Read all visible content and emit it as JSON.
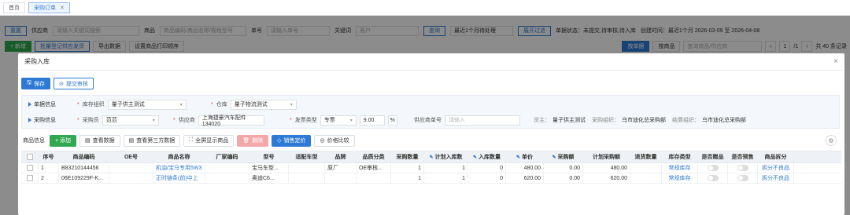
{
  "tabs": [
    {
      "label": "首页",
      "active": false
    },
    {
      "label": "采购订单",
      "active": true
    }
  ],
  "background": {
    "filter": {
      "reset": "重置",
      "supplier_label": "供应商",
      "supplier_placeholder": "请输入关键词搜索",
      "goods_label": "商品",
      "goods_placeholder": "商品编码/商品名称/规格型号",
      "order_no_label": "单号",
      "order_no_placeholder": "请输入单号",
      "keyword_label": "关键词",
      "keyword_placeholder": "客户",
      "search_button": "查询",
      "range_select": "最近1个月待处理",
      "expand_button": "展开过滤",
      "status_text": "单据状态：未提交,待审核,待入库",
      "create_time_text": "创建时间：最近1个月 2026-03-09 至 2026-04-08"
    },
    "toolbar": {
      "add": "+ 新增",
      "batch_register": "批量登记供应发货",
      "export": "导出数据",
      "print_settings": "设置商品打印顺序",
      "by_order": "按单据",
      "by_goods": "按商品",
      "search_placeholder": "查询商品/供应商",
      "page": "1",
      "page_total": "/1",
      "total_text": "共 40 条记录"
    }
  },
  "modal": {
    "title": "采购入库",
    "close": "×",
    "save": "保存",
    "submit_review": "提交审核",
    "form": {
      "section1": "单据信息",
      "stock_org_label": "库存组织",
      "stock_org_value": "量子供主测试",
      "warehouse_label": "仓库",
      "warehouse_value": "量子物流测试",
      "section2": "采购信息",
      "buyer_label": "采购员",
      "buyer_value": "范范",
      "supplier_label": "供应商",
      "supplier_value": "上海捷豪汽车配件134020",
      "invoice_type_label": "发票类型",
      "invoice_type_value": "专票",
      "tax_rate": "9.00",
      "tax_unit": "%",
      "supplier_order_label": "供应商单号",
      "supplier_order_placeholder": "请输入",
      "owner_label": "货主：",
      "owner_value": "量子供主测试",
      "purchase_org_label": "采购组织：",
      "purchase_org_value": "乌市迪化总采购部",
      "settle_org_label": "结算组织：",
      "settle_org_value": "乌市迪化总采购部"
    },
    "goods_section": {
      "title": "商品信息",
      "add": "+ 添加",
      "view_data": "查看数据",
      "view_third": "查看第三方数据",
      "fullscreen": "全屏显示商品",
      "delete": "删除",
      "sale_price": "销售定价",
      "price_compare": "价格比较"
    },
    "table": {
      "headers": [
        "序号",
        "商品编码",
        "OE号",
        "商品名称",
        "厂家编码",
        "型号",
        "适配车型",
        "品牌",
        "品质分类",
        "采购数量",
        "计划入库数",
        "入库数量",
        "单价",
        "采购额",
        "计划采购额",
        "退货数量",
        "库存类型",
        "是否赠品",
        "是否预售",
        "商品拆分"
      ],
      "rows": [
        {
          "seq": "1",
          "code": "B83210144456",
          "oe": "",
          "name": "机油/宝马专用5W3",
          "factory_code": "",
          "model": "宝马车型...",
          "fit": "",
          "brand": "原厂",
          "quality": "OE审核...",
          "purchase_qty": "1",
          "plan_in": "1",
          "in_qty": "0",
          "price": "480.00",
          "amount": "0.00",
          "plan_amount": "480.00",
          "return_qty": "",
          "stock_type": "常规库存",
          "split": "拆分不良品"
        },
        {
          "seq": "2",
          "code": "06E109229F-K...",
          "oe": "",
          "name": "正时链条(前)中上",
          "factory_code": "",
          "model": "奥迪C6...",
          "fit": "",
          "brand": "",
          "quality": "",
          "purchase_qty": "1",
          "plan_in": "1",
          "in_qty": "0",
          "price": "620.00",
          "amount": "0.00",
          "plan_amount": "620.00",
          "return_qty": "",
          "stock_type": "常规库存",
          "split": "拆分不良品"
        }
      ]
    }
  },
  "colors": {
    "primary": "#2d7ad6",
    "green": "#2fa84f",
    "danger": "#f4a7a7"
  }
}
